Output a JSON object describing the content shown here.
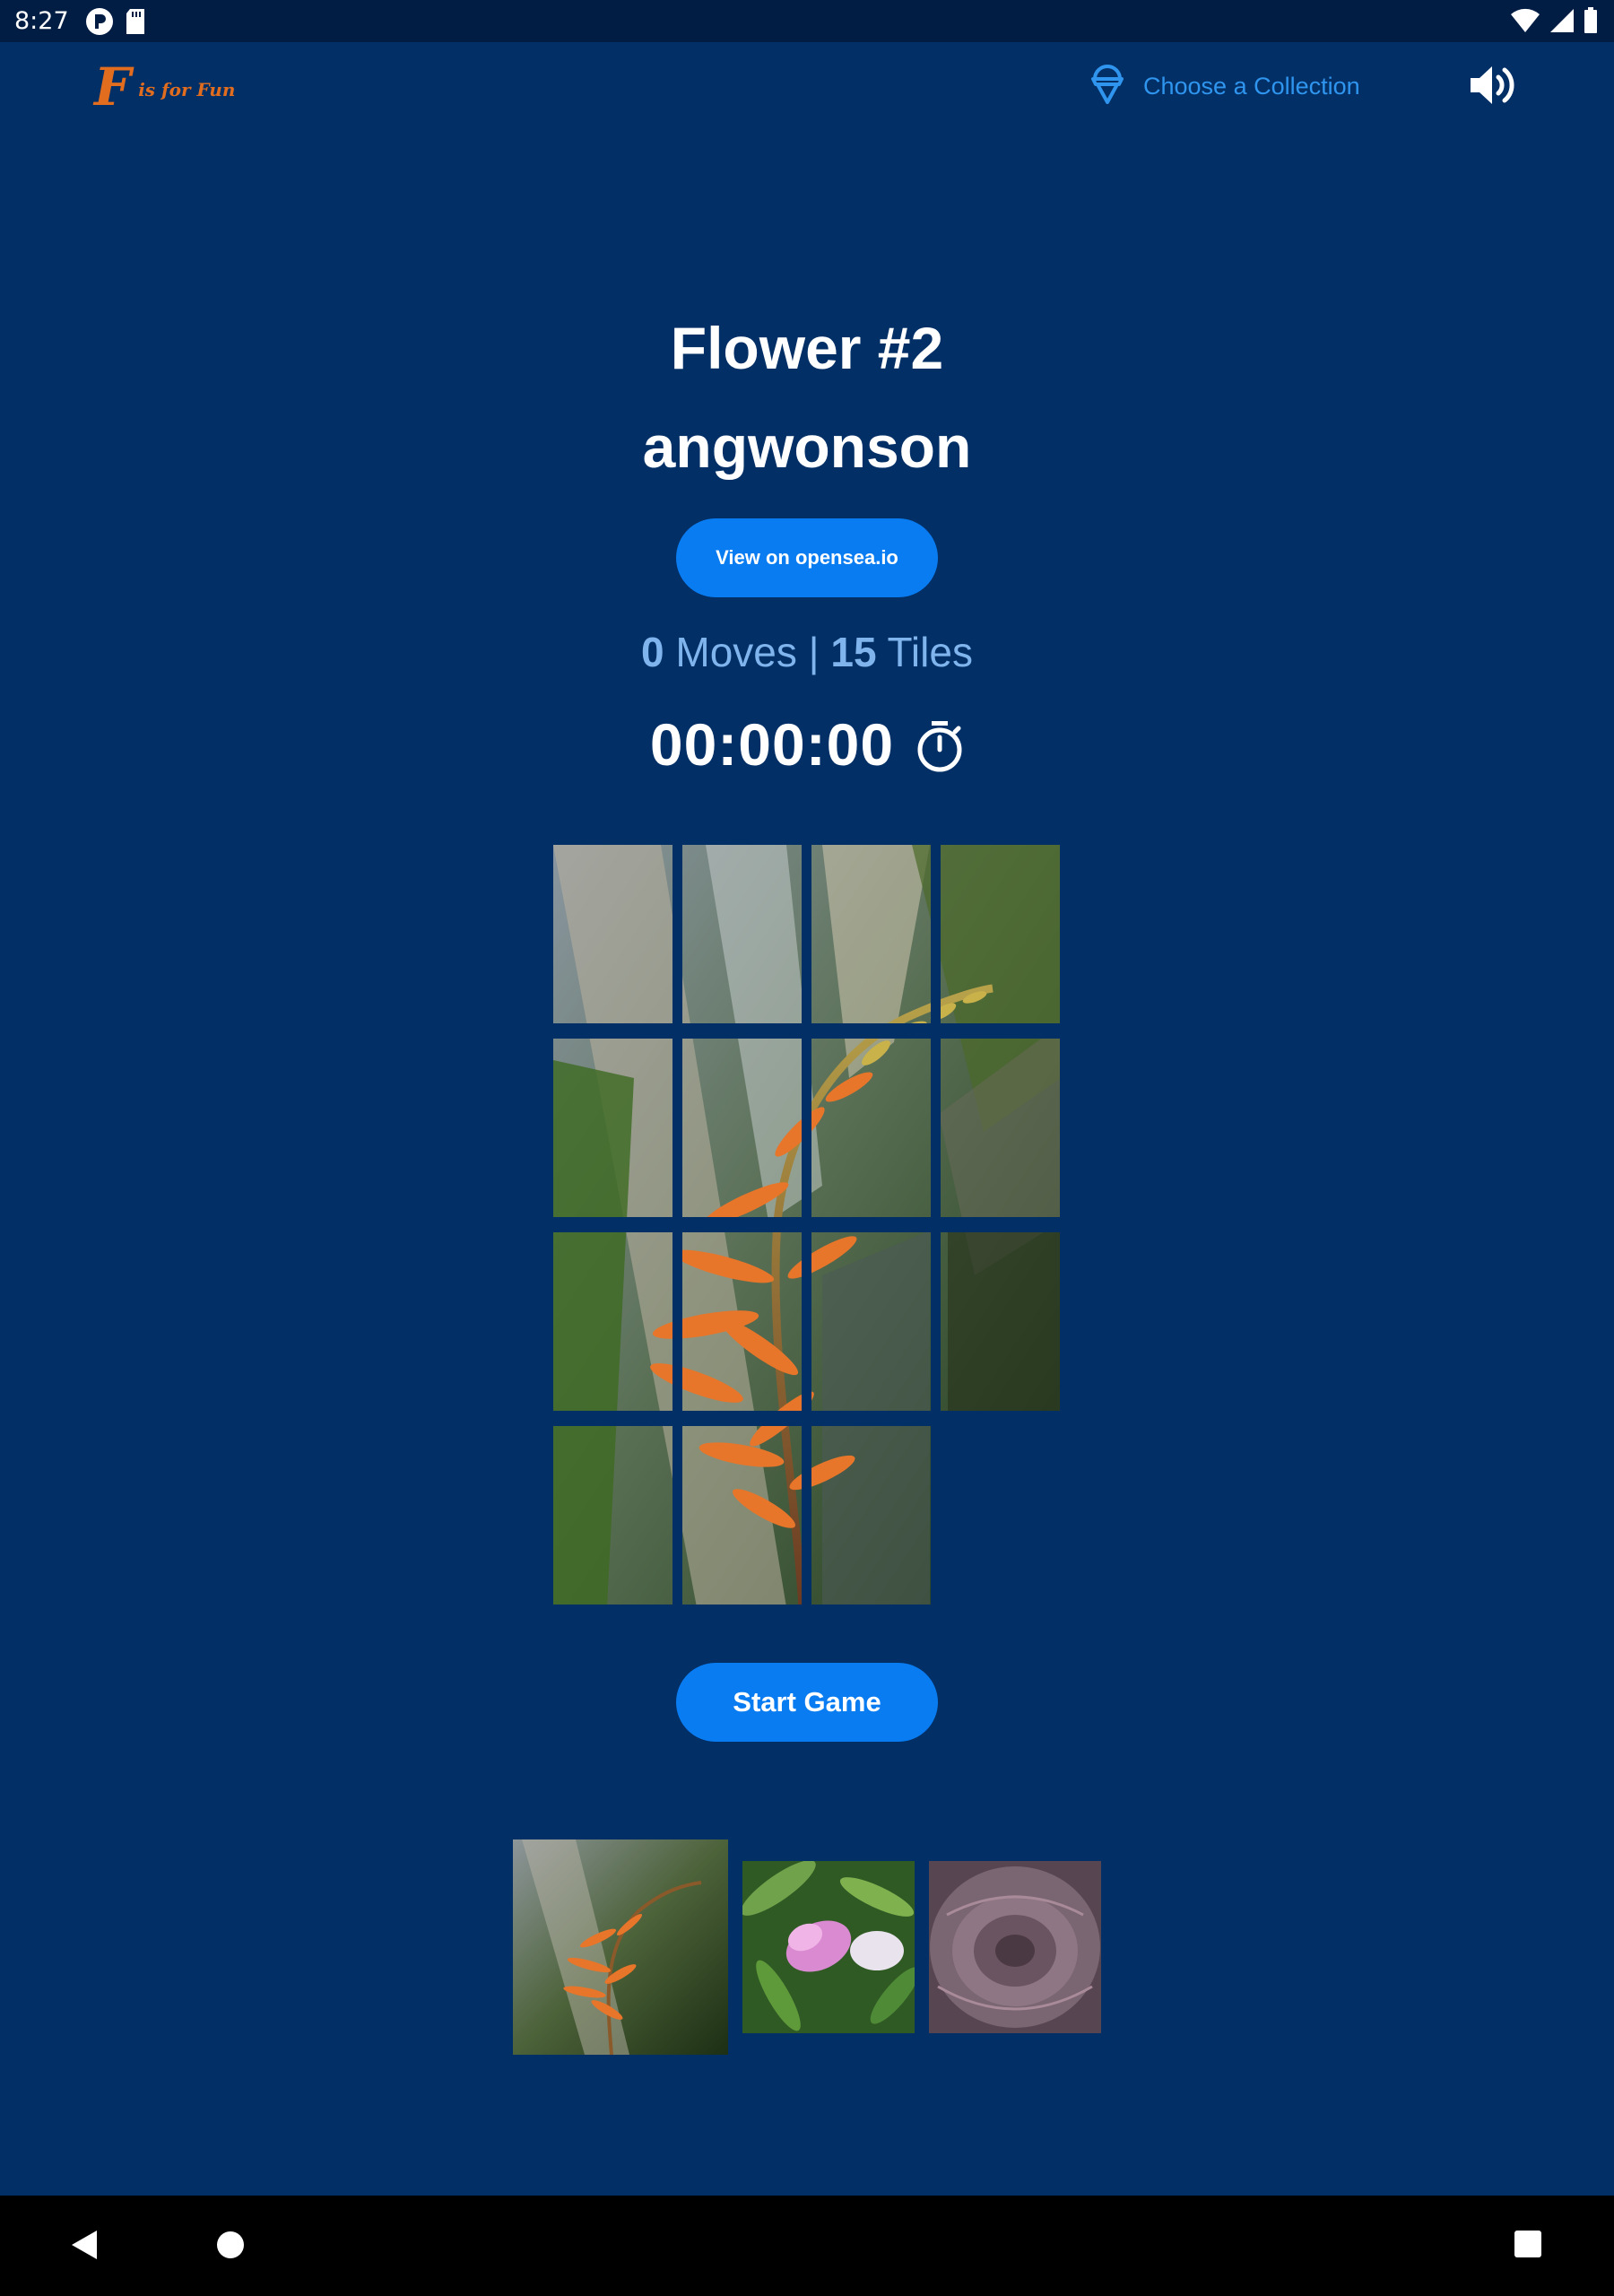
{
  "status_bar": {
    "time": "8:27"
  },
  "header": {
    "logo_letter": "F",
    "logo_text": "is for Fun",
    "collection_label": "Choose a Collection"
  },
  "artwork": {
    "title": "Flower #2",
    "artist": "angwonson",
    "opensea_label": "View on opensea.io"
  },
  "stats": {
    "moves_count": "0",
    "moves_label": "Moves",
    "separator": "|",
    "tiles_count": "15",
    "tiles_label": "Tiles"
  },
  "timer": {
    "value": "00:00:00"
  },
  "board": {
    "grid": "4x4",
    "tiles": 15,
    "empty_slot": 16
  },
  "start_label": "Start Game",
  "thumbnails": [
    {
      "name": "thumb-orange-flower",
      "selected": true
    },
    {
      "name": "thumb-pink-flower",
      "selected": false
    },
    {
      "name": "thumb-succulent",
      "selected": false
    }
  ],
  "colors": {
    "background": "#022f66",
    "accent": "#0a7cf2",
    "link": "#2f95ee",
    "logo": "#e26d1f",
    "stats": "#7fb4ec"
  }
}
